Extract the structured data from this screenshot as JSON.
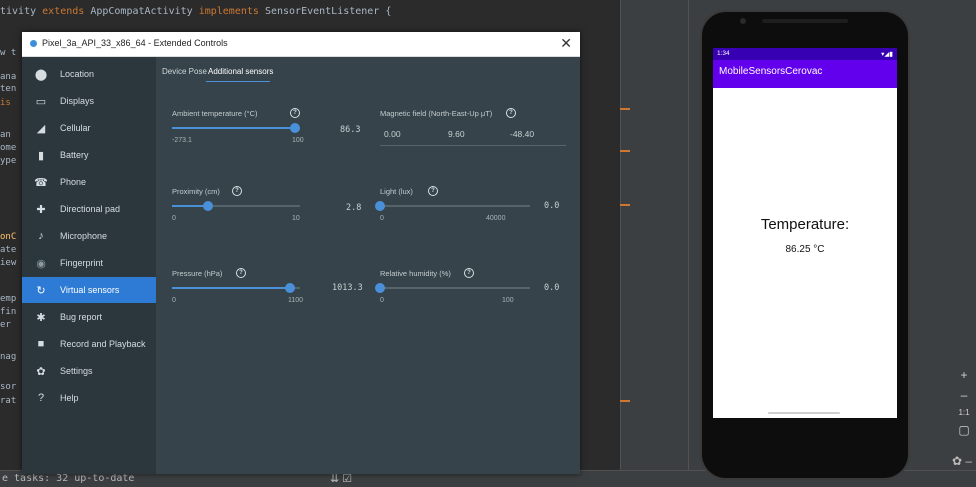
{
  "ide": {
    "code_top": [
      "tivity ",
      "extends",
      " AppCompatActivity ",
      "implements",
      " SensorEventListener {"
    ],
    "code_fragments": [
      "w t",
      "ana",
      "ten",
      "is",
      "an",
      "ome",
      "ype",
      "onC",
      "ate",
      "iew",
      "emp",
      "fin",
      "er",
      "nag",
      "sor",
      "rat"
    ],
    "bottom_status": "e tasks: 32 up-to-date"
  },
  "dialog": {
    "title": "Pixel_3a_API_33_x86_64 - Extended Controls",
    "close_glyph": "✕",
    "tabs": [
      "Device Pose",
      "Additional sensors"
    ],
    "selected_tab": 1,
    "sidebar": [
      {
        "label": "Location",
        "icon": "location-pin-icon",
        "glyph": "⬤"
      },
      {
        "label": "Displays",
        "icon": "display-icon",
        "glyph": "▭"
      },
      {
        "label": "Cellular",
        "icon": "cellular-signal-icon",
        "glyph": "◢"
      },
      {
        "label": "Battery",
        "icon": "battery-icon",
        "glyph": "▮"
      },
      {
        "label": "Phone",
        "icon": "phone-icon",
        "glyph": "☎"
      },
      {
        "label": "Directional pad",
        "icon": "dpad-icon",
        "glyph": "✚"
      },
      {
        "label": "Microphone",
        "icon": "microphone-icon",
        "glyph": "♪"
      },
      {
        "label": "Fingerprint",
        "icon": "fingerprint-icon",
        "glyph": "◉"
      },
      {
        "label": "Virtual sensors",
        "icon": "virtual-sensors-icon",
        "glyph": "↻"
      },
      {
        "label": "Bug report",
        "icon": "bug-icon",
        "glyph": "✱"
      },
      {
        "label": "Record and Playback",
        "icon": "record-icon",
        "glyph": "■"
      },
      {
        "label": "Settings",
        "icon": "settings-gear-icon",
        "glyph": "✿"
      },
      {
        "label": "Help",
        "icon": "help-icon",
        "glyph": "?"
      }
    ],
    "active_item": 8,
    "sensors": {
      "ambient_temp": {
        "label": "Ambient temperature (°C)",
        "min": "-273.1",
        "max": "100",
        "value": "86.3",
        "fraction": 0.96
      },
      "magnetic": {
        "label": "Magnetic field (North-East-Up μT)",
        "values": [
          "0.00",
          "9.60",
          "-48.40"
        ]
      },
      "proximity": {
        "label": "Proximity (cm)",
        "min": "0",
        "max": "10",
        "value": "2.8",
        "fraction": 0.28
      },
      "light": {
        "label": "Light (lux)",
        "min": "0",
        "max": "40000",
        "value": "0.0",
        "fraction": 0.0
      },
      "pressure": {
        "label": "Pressure (hPa)",
        "min": "0",
        "max": "1100",
        "value": "1013.3",
        "fraction": 0.92
      },
      "humidity": {
        "label": "Relative humidity (%)",
        "min": "0",
        "max": "100",
        "value": "0.0",
        "fraction": 0.0
      }
    }
  },
  "phone": {
    "status_time": "1:34",
    "status_icons": "▾◢▮",
    "app_title": "MobileSensorsCerovac",
    "temperature_label": "Temperature:",
    "temperature_value": "86.25 °C"
  },
  "colors": {
    "accent": "#4a90d9",
    "active_nav": "#2e7bd6",
    "app_bar": "#6200ee",
    "status_bar": "#3700b3"
  }
}
